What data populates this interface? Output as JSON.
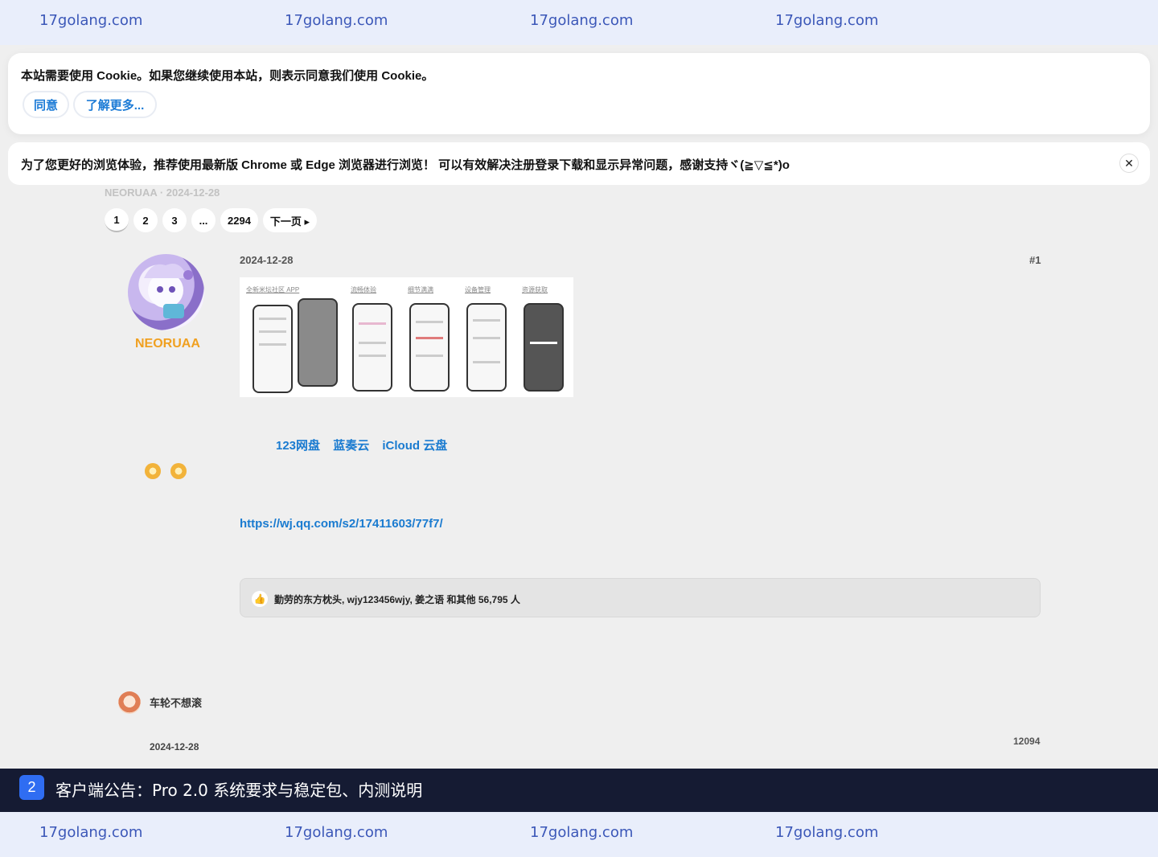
{
  "watermarks": [
    "17golang.com",
    "17golang.com",
    "17golang.com",
    "17golang.com"
  ],
  "cookie_banner": {
    "message": "本站需要使用 Cookie。如果您继续使用本站，则表示同意我们使用 Cookie。",
    "agree_label": "同意",
    "more_label": "了解更多..."
  },
  "browser_notice": {
    "message": "为了您更好的浏览体验，推荐使用最新版 Chrome 或 Edge 浏览器进行浏览！ 可以有效解决注册登录下载和显示异常问题，感谢支持ヾ(≧▽≦*)o",
    "close_label": "✕"
  },
  "topic_meta": "NEORUAA · 2024-12-28",
  "pagination": [
    "1",
    "2",
    "3",
    "...",
    "2294",
    "下一页 ▸"
  ],
  "post": {
    "date": "2024-12-28",
    "number": "#1",
    "author": "NEORUAA",
    "screenshot_captions": [
      "全新米坛社区 APP",
      "流畅体验",
      "细节满满",
      "设备管理",
      "资源获取"
    ],
    "download_links": [
      "123网盘",
      "蓝奏云",
      "iCloud 云盘"
    ],
    "survey_url": "https://wj.qq.com/s2/17411603/77f7/",
    "likes_text": "勤劳的东方枕头, wjy123456wjy, 姜之语 和其他 56,795 人"
  },
  "reply": {
    "user": "车轮不想滚",
    "date": "2024-12-28",
    "views": "12094"
  },
  "announcement": {
    "badge": "2",
    "title": "客户端公告：Pro 2.0 系统要求与稳定包、内测说明"
  },
  "colors": {
    "link": "#1a7bd0",
    "author": "#f0a020",
    "announce_bg": "#151b33",
    "badge": "#2f6df2",
    "watermark_bg": "#e9eefb"
  }
}
